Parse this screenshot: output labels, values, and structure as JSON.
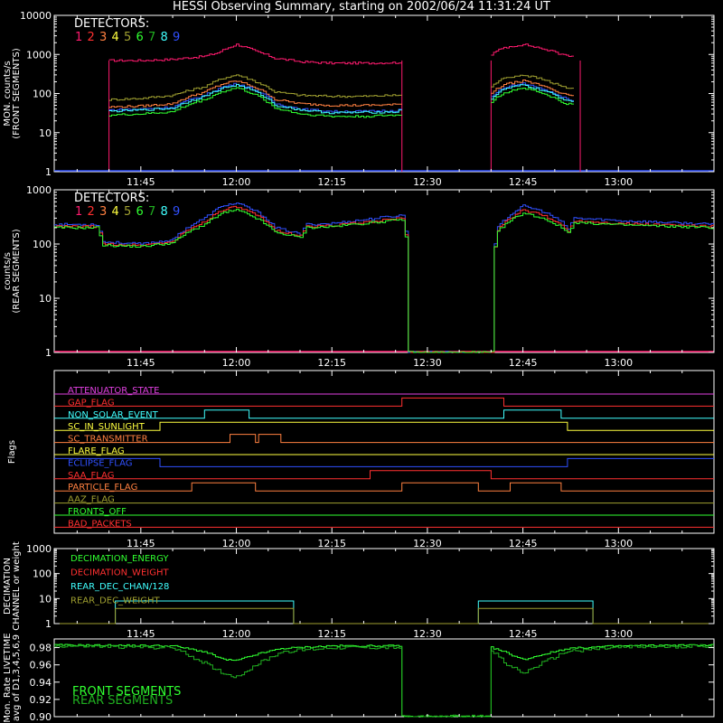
{
  "title": "HESSI Observing Summary, starting on 2002/06/24 11:31:24 UT",
  "colors": {
    "background": "#000000",
    "axes": "#ffffff",
    "det1": "#ff1a6e",
    "det2": "#ff3030",
    "det3": "#ff8040",
    "det4": "#ffff40",
    "det5": "#a0a030",
    "det6": "#30ff30",
    "det7": "#20b020",
    "det8": "#40ffff",
    "det9": "#3050ff"
  },
  "chart_data": [
    {
      "id": "front",
      "type": "line",
      "ylabel": [
        "MON. counts/s",
        "(FRONT SEGMENTS)"
      ],
      "yscale": "log",
      "ylim": [
        1,
        10000
      ],
      "yticks": [
        "1",
        "10",
        "100",
        "1000",
        "10000"
      ],
      "xlim": [
        "11:31:24",
        "13:15"
      ],
      "xticks": [
        "11:45",
        "12:00",
        "12:15",
        "12:30",
        "12:45",
        "13:00"
      ],
      "legend_title": "DETECTORS:",
      "legend_items": [
        "1",
        "2",
        "3",
        "4",
        "5",
        "6",
        "7",
        "8",
        "9"
      ],
      "observing_windows": [
        [
          "11:40",
          "12:26"
        ],
        [
          "12:40",
          "12:54"
        ]
      ],
      "series": [
        {
          "name": "1",
          "color": "#ff1a6e",
          "x": [
            "11:40",
            "11:45",
            "11:50",
            "11:55",
            "11:57",
            "12:00",
            "12:03",
            "12:06",
            "12:10",
            "12:15",
            "12:20",
            "12:25",
            "12:26",
            "12:40",
            "12:42",
            "12:45",
            "12:48",
            "12:51",
            "12:53"
          ],
          "y": [
            700,
            700,
            750,
            900,
            1100,
            1800,
            1200,
            800,
            650,
            600,
            600,
            620,
            650,
            1000,
            1500,
            1800,
            1400,
            1000,
            900
          ]
        },
        {
          "name": "5",
          "color": "#a0a030",
          "x": [
            "11:40",
            "11:45",
            "11:50",
            "11:55",
            "11:58",
            "12:00",
            "12:03",
            "12:06",
            "12:10",
            "12:15",
            "12:20",
            "12:25",
            "12:26",
            "12:40",
            "12:42",
            "12:45",
            "12:48",
            "12:51",
            "12:53"
          ],
          "y": [
            70,
            75,
            90,
            150,
            250,
            300,
            200,
            110,
            90,
            85,
            85,
            90,
            95,
            150,
            250,
            300,
            230,
            150,
            130
          ]
        },
        {
          "name": "3",
          "color": "#ff8040",
          "x": [
            "11:40",
            "11:45",
            "11:50",
            "11:55",
            "11:58",
            "12:00",
            "12:03",
            "12:06",
            "12:10",
            "12:15",
            "12:20",
            "12:25",
            "12:26",
            "12:40",
            "12:42",
            "12:45",
            "12:48",
            "12:51",
            "12:53"
          ],
          "y": [
            45,
            48,
            55,
            110,
            180,
            210,
            140,
            70,
            55,
            50,
            50,
            52,
            55,
            100,
            170,
            210,
            160,
            100,
            80
          ]
        },
        {
          "name": "9",
          "color": "#3050ff",
          "x": [
            "11:40",
            "11:45",
            "11:50",
            "11:55",
            "11:58",
            "12:00",
            "12:03",
            "12:06",
            "12:10",
            "12:15",
            "12:20",
            "12:25",
            "12:26",
            "12:40",
            "12:42",
            "12:45",
            "12:48",
            "12:51",
            "12:53"
          ],
          "y": [
            38,
            40,
            45,
            90,
            150,
            180,
            120,
            55,
            40,
            35,
            35,
            37,
            40,
            80,
            140,
            180,
            130,
            80,
            65
          ]
        },
        {
          "name": "8",
          "color": "#40ffff",
          "x": [
            "11:40",
            "11:45",
            "11:50",
            "11:55",
            "11:58",
            "12:00",
            "12:03",
            "12:06",
            "12:10",
            "12:15",
            "12:20",
            "12:25",
            "12:26",
            "12:40",
            "12:42",
            "12:45",
            "12:48",
            "12:51",
            "12:53"
          ],
          "y": [
            35,
            38,
            42,
            85,
            140,
            165,
            110,
            50,
            38,
            32,
            33,
            34,
            38,
            75,
            130,
            165,
            120,
            75,
            60
          ]
        },
        {
          "name": "6",
          "color": "#30ff30",
          "x": [
            "11:40",
            "11:45",
            "11:50",
            "11:55",
            "11:58",
            "12:00",
            "12:03",
            "12:06",
            "12:10",
            "12:15",
            "12:20",
            "12:25",
            "12:26",
            "12:40",
            "12:42",
            "12:45",
            "12:48",
            "12:51",
            "12:53"
          ],
          "y": [
            28,
            30,
            34,
            70,
            115,
            140,
            90,
            42,
            30,
            26,
            26,
            28,
            30,
            60,
            105,
            140,
            100,
            60,
            50
          ]
        }
      ]
    },
    {
      "id": "rear",
      "type": "line",
      "ylabel": [
        "counts/s",
        "(REAR SEGMENTS)"
      ],
      "yscale": "log",
      "ylim": [
        1,
        1000
      ],
      "yticks": [
        "1",
        "10",
        "100",
        "1000"
      ],
      "xlim": [
        "11:31:24",
        "13:15"
      ],
      "xticks": [
        "11:45",
        "12:00",
        "12:15",
        "12:30",
        "12:45",
        "13:00"
      ],
      "legend_title": "DETECTORS:",
      "legend_items": [
        "1",
        "2",
        "3",
        "4",
        "5",
        "6",
        "7",
        "8",
        "9"
      ],
      "series": [
        {
          "name": "9",
          "color": "#3050ff",
          "x": [
            "11:31:24",
            "11:38",
            "11:39",
            "11:45",
            "11:50",
            "11:55",
            "11:58",
            "12:00",
            "12:03",
            "12:06",
            "12:10",
            "12:11",
            "12:15",
            "12:20",
            "12:26",
            "12:27",
            "12:40",
            "12:41",
            "12:43",
            "12:45",
            "12:48",
            "12:51",
            "12:52",
            "12:53",
            "13:00",
            "13:15"
          ],
          "y": [
            230,
            230,
            110,
            100,
            120,
            300,
            520,
            560,
            400,
            200,
            150,
            230,
            240,
            280,
            340,
            1,
            1,
            200,
            350,
            500,
            400,
            250,
            190,
            300,
            270,
            230
          ]
        },
        {
          "name": "2",
          "color": "#ff3030",
          "x": [
            "11:31:24",
            "11:38",
            "11:39",
            "11:45",
            "11:50",
            "11:55",
            "11:58",
            "12:00",
            "12:03",
            "12:06",
            "12:10",
            "12:11",
            "12:15",
            "12:20",
            "12:26",
            "12:27",
            "12:40",
            "12:41",
            "12:43",
            "12:45",
            "12:48",
            "12:51",
            "12:52",
            "12:53",
            "13:00",
            "13:15"
          ],
          "y": [
            210,
            210,
            100,
            95,
            110,
            260,
            440,
            480,
            340,
            180,
            140,
            210,
            220,
            250,
            300,
            1,
            1,
            180,
            300,
            420,
            340,
            220,
            170,
            270,
            240,
            210
          ]
        },
        {
          "name": "6",
          "color": "#30ff30",
          "x": [
            "11:31:24",
            "11:38",
            "11:39",
            "11:45",
            "11:50",
            "11:55",
            "11:58",
            "12:00",
            "12:03",
            "12:06",
            "12:10",
            "12:11",
            "12:15",
            "12:20",
            "12:26",
            "12:27",
            "12:40",
            "12:41",
            "12:43",
            "12:45",
            "12:48",
            "12:51",
            "12:52",
            "12:53",
            "13:00",
            "13:15"
          ],
          "y": [
            200,
            200,
            95,
            90,
            105,
            230,
            380,
            420,
            300,
            165,
            130,
            200,
            210,
            240,
            280,
            1,
            1,
            170,
            270,
            370,
            300,
            200,
            160,
            250,
            225,
            200
          ]
        }
      ]
    },
    {
      "id": "flags",
      "type": "line",
      "ylabel": [
        "Flags"
      ],
      "xticks": [
        "11:45",
        "12:00",
        "12:15",
        "12:30",
        "12:45",
        "13:00"
      ],
      "flags": [
        {
          "name": "ATTENUATOR_STATE",
          "color": "#e040e0",
          "steps": [
            [
              "11:31:24",
              0
            ]
          ]
        },
        {
          "name": "GAP_FLAG",
          "color": "#ff3030",
          "steps": [
            [
              "11:31:24",
              0
            ],
            [
              "12:26",
              1
            ],
            [
              "12:42",
              0
            ]
          ]
        },
        {
          "name": "NON_SOLAR_EVENT",
          "color": "#40ffff",
          "steps": [
            [
              "11:31:24",
              0
            ],
            [
              "11:55",
              1
            ],
            [
              "12:02",
              0
            ],
            [
              "12:42",
              1
            ],
            [
              "12:51",
              0
            ]
          ]
        },
        {
          "name": "SC_IN_SUNLIGHT",
          "color": "#ffff40",
          "steps": [
            [
              "11:31:24",
              0
            ],
            [
              "11:48",
              1
            ],
            [
              "12:52",
              0
            ]
          ]
        },
        {
          "name": "SC_TRANSMITTER",
          "color": "#ff8040",
          "steps": [
            [
              "11:31:24",
              0
            ],
            [
              "11:59",
              1
            ],
            [
              "12:03",
              0
            ],
            [
              "12:03:30",
              1
            ],
            [
              "12:07",
              0
            ]
          ]
        },
        {
          "name": "FLARE_FLAG",
          "color": "#ffff40",
          "steps": [
            [
              "11:31:24",
              0
            ]
          ]
        },
        {
          "name": "ECLIPSE_FLAG",
          "color": "#3050ff",
          "steps": [
            [
              "11:31:24",
              1
            ],
            [
              "11:48",
              0
            ],
            [
              "12:52",
              1
            ]
          ]
        },
        {
          "name": "SAA_FLAG",
          "color": "#ff3030",
          "steps": [
            [
              "11:31:24",
              0
            ],
            [
              "12:21",
              1
            ],
            [
              "12:40",
              0
            ]
          ]
        },
        {
          "name": "PARTICLE_FLAG",
          "color": "#ff8040",
          "steps": [
            [
              "11:31:24",
              0
            ],
            [
              "11:53",
              1
            ],
            [
              "12:03",
              0
            ],
            [
              "12:26",
              1
            ],
            [
              "12:38",
              0
            ],
            [
              "12:43",
              1
            ],
            [
              "12:51",
              0
            ]
          ]
        },
        {
          "name": "AAZ_FLAG",
          "color": "#a0a030",
          "steps": [
            [
              "11:31:24",
              0
            ]
          ]
        },
        {
          "name": "FRONTS_OFF",
          "color": "#30ff30",
          "steps": [
            [
              "11:31:24",
              0
            ]
          ]
        },
        {
          "name": "BAD_PACKETS",
          "color": "#ff3030",
          "steps": [
            [
              "11:31:24",
              0
            ]
          ]
        }
      ]
    },
    {
      "id": "decimation",
      "type": "line",
      "ylabel": [
        "DECIMATION",
        "CHANNEL or weight"
      ],
      "yscale": "log",
      "ylim": [
        1,
        1000
      ],
      "yticks": [
        "1",
        "10",
        "100",
        "1000"
      ],
      "xticks": [
        "11:45",
        "12:00",
        "12:15",
        "12:30",
        "12:45",
        "13:00"
      ],
      "legend_items": [
        {
          "name": "DECIMATION_ENERGY",
          "color": "#30ff30"
        },
        {
          "name": "DECIMATION_WEIGHT",
          "color": "#ff3030"
        },
        {
          "name": "REAR_DEC_CHAN/128",
          "color": "#40ffff"
        },
        {
          "name": "REAR_DEC_WEIGHT",
          "color": "#a0a030"
        }
      ],
      "series": [
        {
          "name": "REAR_DEC_CHAN/128",
          "color": "#40ffff",
          "x": [
            "11:31:24",
            "11:41",
            "11:41",
            "12:09",
            "12:09",
            "12:38",
            "12:38",
            "12:56",
            "12:56",
            "13:15"
          ],
          "y": [
            1,
            1,
            8,
            8,
            1,
            1,
            8,
            8,
            1,
            1
          ]
        },
        {
          "name": "REAR_DEC_WEIGHT",
          "color": "#a0a030",
          "x": [
            "11:31:24",
            "11:41",
            "11:41",
            "12:09",
            "12:09",
            "12:38",
            "12:38",
            "12:56",
            "12:56",
            "13:15"
          ],
          "y": [
            1,
            1,
            4,
            4,
            1,
            1,
            4,
            4,
            1,
            1
          ]
        }
      ]
    },
    {
      "id": "livetime",
      "type": "line",
      "ylabel": [
        "Mon. Rate LIVETIME",
        "avg of D1,3,4,5,6,9"
      ],
      "ylim": [
        0.9,
        0.99
      ],
      "yticks": [
        "0.90",
        "0.92",
        "0.94",
        "0.96",
        "0.98"
      ],
      "legend_items": [
        {
          "name": "FRONT SEGMENTS",
          "color": "#30ff30"
        },
        {
          "name": "REAR SEGMENTS",
          "color": "#20b020"
        }
      ],
      "series": [
        {
          "name": "FRONT SEGMENTS",
          "color": "#30ff30",
          "x": [
            "11:31:24",
            "11:50",
            "11:55",
            "11:58",
            "12:00",
            "12:03",
            "12:07",
            "12:15",
            "12:26",
            "12:26",
            "12:40",
            "12:40",
            "12:42",
            "12:45",
            "12:48",
            "12:52",
            "13:00",
            "13:15"
          ],
          "y": [
            0.983,
            0.982,
            0.975,
            0.966,
            0.965,
            0.972,
            0.979,
            0.982,
            0.982,
            0.9,
            0.9,
            0.98,
            0.975,
            0.966,
            0.972,
            0.979,
            0.982,
            0.983
          ]
        },
        {
          "name": "REAR SEGMENTS",
          "color": "#20b020",
          "x": [
            "11:31:24",
            "11:50",
            "11:55",
            "11:58",
            "12:00",
            "12:03",
            "12:07",
            "12:15",
            "12:26",
            "12:26",
            "12:40",
            "12:40",
            "12:42",
            "12:45",
            "12:48",
            "12:52",
            "13:00",
            "13:15"
          ],
          "y": [
            0.982,
            0.98,
            0.962,
            0.95,
            0.946,
            0.96,
            0.975,
            0.98,
            0.98,
            0.9,
            0.9,
            0.978,
            0.963,
            0.95,
            0.962,
            0.976,
            0.98,
            0.982
          ]
        }
      ]
    }
  ]
}
